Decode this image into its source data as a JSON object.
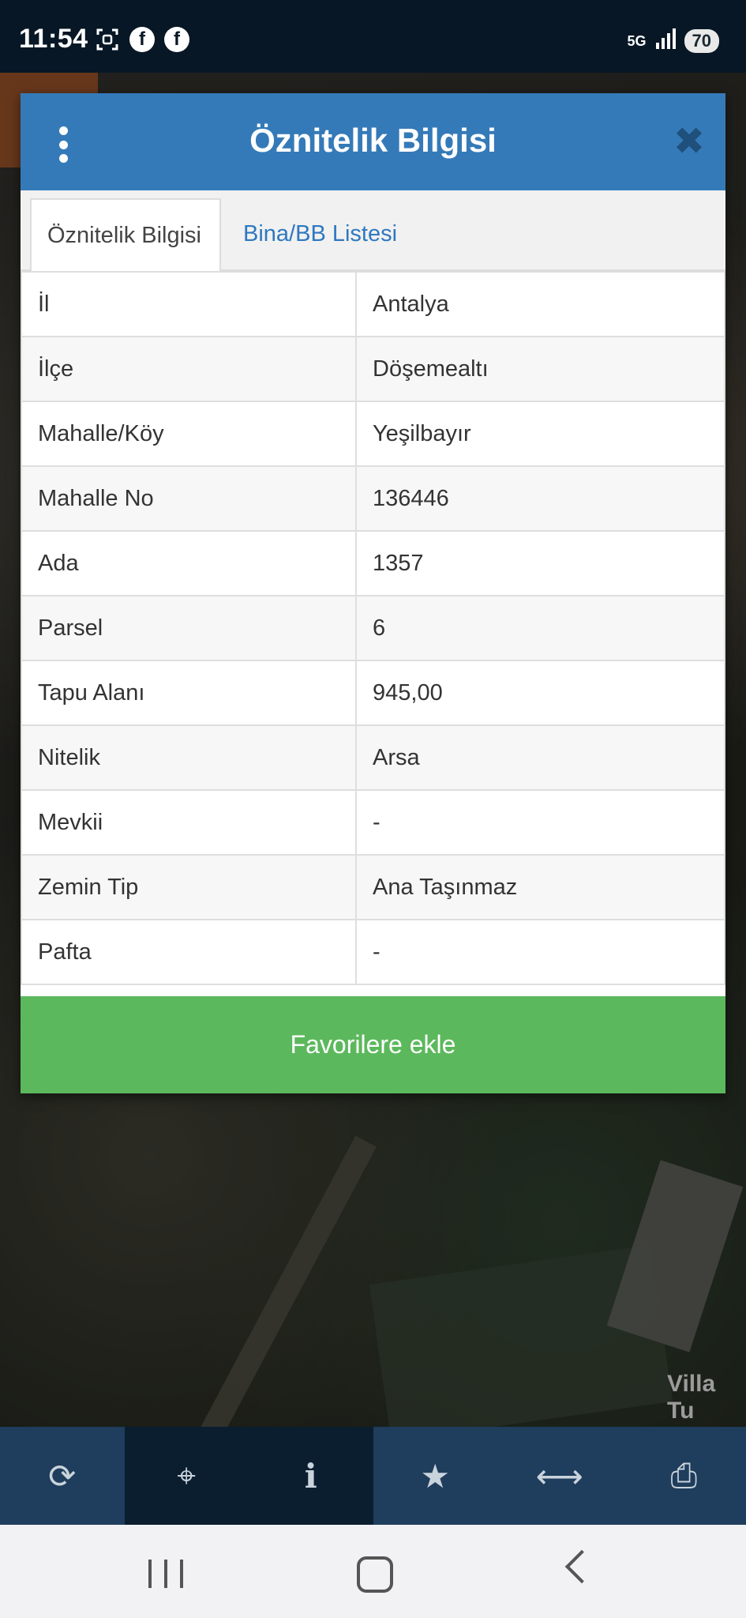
{
  "status_bar": {
    "time": "11:54",
    "network": "5G",
    "battery": "70",
    "icons": [
      "screenshot-icon",
      "facebook-icon",
      "facebook-icon",
      "signal-icon"
    ]
  },
  "map": {
    "place_label": "Villa Tu"
  },
  "dialog": {
    "title": "Öznitelik Bilgisi",
    "close_symbol": "✖",
    "tabs": [
      {
        "label": "Öznitelik Bilgisi",
        "active": true
      },
      {
        "label": "Bina/BB Listesi",
        "active": false
      }
    ],
    "rows": [
      {
        "key": "İl",
        "value": "Antalya"
      },
      {
        "key": "İlçe",
        "value": "Döşemealtı"
      },
      {
        "key": "Mahalle/Köy",
        "value": "Yeşilbayır"
      },
      {
        "key": "Mahalle No",
        "value": "136446"
      },
      {
        "key": "Ada",
        "value": "1357"
      },
      {
        "key": "Parsel",
        "value": "6"
      },
      {
        "key": "Tapu Alanı",
        "value": "945,00"
      },
      {
        "key": "Nitelik",
        "value": "Arsa"
      },
      {
        "key": "Mevkii",
        "value": "-"
      },
      {
        "key": "Zemin Tip",
        "value": "Ana Taşınmaz"
      },
      {
        "key": "Pafta",
        "value": "-"
      }
    ],
    "favorite_button": "Favorilere ekle"
  },
  "toolbar": {
    "tools": [
      {
        "name": "refresh-icon",
        "glyph": "⟳"
      },
      {
        "name": "locate-icon",
        "glyph": "⌖"
      },
      {
        "name": "info-icon",
        "glyph": "i"
      },
      {
        "name": "star-icon",
        "glyph": "★"
      },
      {
        "name": "measure-icon",
        "glyph": "⟷"
      },
      {
        "name": "print-icon",
        "glyph": "⎙"
      }
    ]
  },
  "colors": {
    "header": "#357ab8",
    "favorite": "#5cb85c",
    "toolbar": "#1f3d5c",
    "tab_link": "#2f78c0"
  }
}
